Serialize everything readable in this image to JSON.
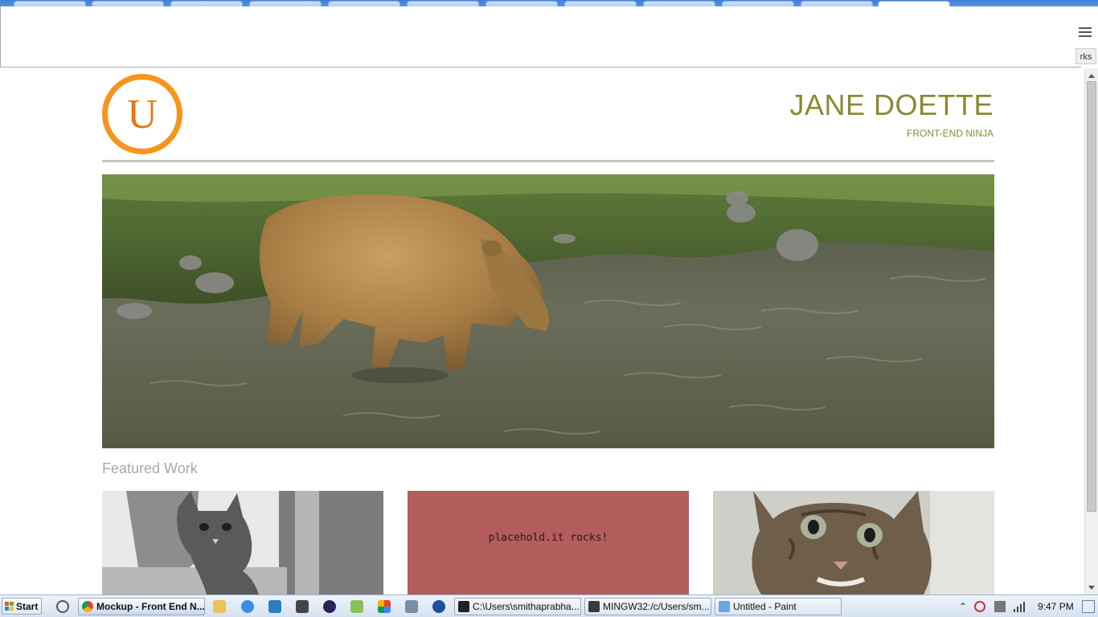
{
  "browser": {
    "bookmarks_overflow": "rks"
  },
  "page": {
    "logo_letter": "U",
    "name": "JANE DOETTE",
    "subtitle": "FRONT-END NINJA",
    "featured_heading": "Featured Work",
    "placeholder_text": "placehold.it rocks!"
  },
  "taskbar": {
    "start_label": "Start",
    "tasks": [
      {
        "label": "Mockup - Front End N..."
      },
      {
        "label": "C:\\Users\\smithaprabha..."
      },
      {
        "label": "MINGW32:/c/Users/sm..."
      },
      {
        "label": "Untitled - Paint"
      }
    ],
    "clock": "9:47 PM"
  },
  "colors": {
    "accent_orange": "#f7941d",
    "name_olive": "#8a8a2e",
    "placeholder_red": "#b35d5c",
    "divider_gray": "#c4c4c4"
  }
}
